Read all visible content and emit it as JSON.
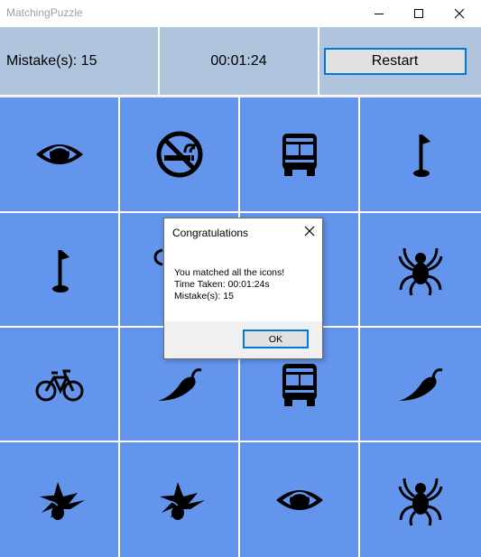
{
  "window": {
    "title": "MatchingPuzzle"
  },
  "status": {
    "mistakes_text": "Mistake(s): 15",
    "time_text": "00:01:24",
    "restart_label": "Restart"
  },
  "colors": {
    "tile": "#6495ed",
    "status_bg": "#b0c4de",
    "accent": "#0078d7"
  },
  "board": {
    "rows": [
      [
        "eye-icon",
        "no-smoking-icon",
        "bus-icon",
        "golf-flag-icon"
      ],
      [
        "golf-flag-icon",
        "hidden-tile",
        "hidden-tile",
        "spider-icon"
      ],
      [
        "bicycle-icon",
        "chili-pepper-icon",
        "bus-icon",
        "chili-pepper-icon"
      ],
      [
        "bird-icon",
        "bird-icon",
        "eye-icon",
        "spider-icon"
      ]
    ]
  },
  "dialog": {
    "title": "Congratulations",
    "line1": "You matched all the icons!",
    "line2": "Time Taken: 00:01:24s",
    "line3": "Mistake(s): 15",
    "ok_label": "OK"
  }
}
